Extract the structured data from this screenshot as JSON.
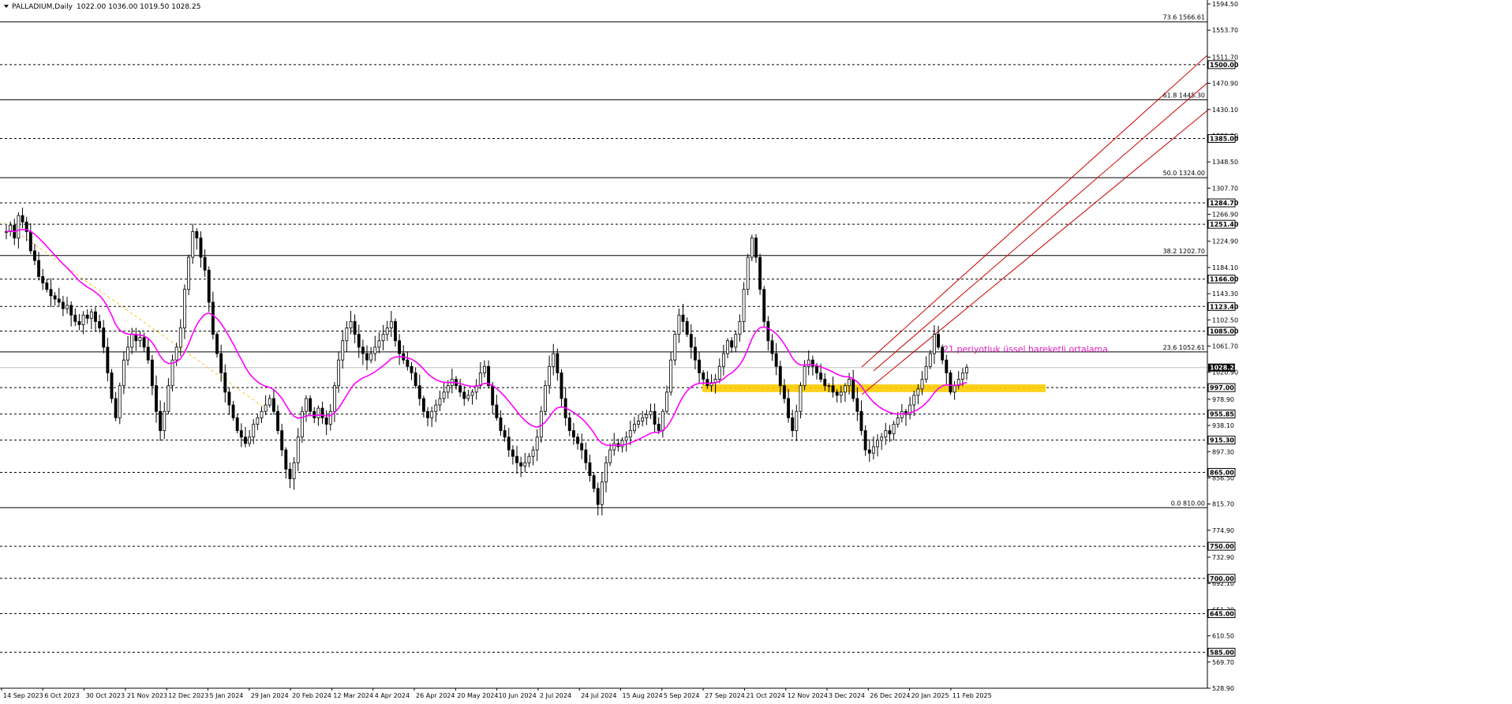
{
  "header": {
    "symbol_label": "PALLADIUM,Daily",
    "ohlc": "1022.00 1036.00 1019.50 1028.25"
  },
  "colors": {
    "background": "#ffffff",
    "candles": "#000000",
    "ema": "#ff00ff",
    "channel": "#cc0000",
    "zone": "#ffcc00",
    "guide": "#f5c842",
    "price_box": "#000000"
  },
  "chart_data": {
    "type": "candlestick",
    "title": "PALLADIUM,Daily",
    "ylim": [
      528.9,
      1594.5
    ],
    "y_ticks": [
      "1594.50",
      "1553.70",
      "1511.70",
      "1470.90",
      "1430.10",
      "1389.30",
      "1348.50",
      "1307.70",
      "1266.90",
      "1224.90",
      "1184.10",
      "1143.30",
      "1102.50",
      "1061.70",
      "1020.90",
      "978.90",
      "938.10",
      "897.30",
      "856.50",
      "815.70",
      "774.90",
      "732.90",
      "692.10",
      "651.30",
      "610.50",
      "569.70",
      "528.90"
    ],
    "x_labels": [
      "14 Sep 2023",
      "6 Oct 2023",
      "30 Oct 2023",
      "21 Nov 2023",
      "12 Dec 2023",
      "5 Jan 2024",
      "29 Jan 2024",
      "20 Feb 2024",
      "12 Mar 2024",
      "4 Apr 2024",
      "26 Apr 2024",
      "20 May 2024",
      "10 Jun 2024",
      "2 Jul 2024",
      "24 Jul 2024",
      "15 Aug 2024",
      "5 Sep 2024",
      "27 Sep 2024",
      "21 Oct 2024",
      "12 Nov 2024",
      "3 Dec 2024",
      "26 Dec 2024",
      "20 Jan 2025",
      "11 Feb 2025"
    ],
    "price_levels": [
      {
        "value": 1500.0,
        "label": "1500.00"
      },
      {
        "value": 1385.0,
        "label": "1385.00"
      },
      {
        "value": 1284.7,
        "label": "1284.70"
      },
      {
        "value": 1251.4,
        "label": "1251.40"
      },
      {
        "value": 1166.0,
        "label": "1166.00"
      },
      {
        "value": 1123.4,
        "label": "1123.40"
      },
      {
        "value": 1085.0,
        "label": "1085.00"
      },
      {
        "value": 997.0,
        "label": "997.00"
      },
      {
        "value": 955.85,
        "label": "955.85"
      },
      {
        "value": 915.3,
        "label": "915.30"
      },
      {
        "value": 865.0,
        "label": "865.00"
      },
      {
        "value": 750.0,
        "label": "750.00"
      },
      {
        "value": 700.0,
        "label": "700.00"
      },
      {
        "value": 645.0,
        "label": "645.00"
      },
      {
        "value": 585.0,
        "label": "585.00"
      }
    ],
    "fib_levels": [
      {
        "value": 1566.61,
        "label": "73.6 1566.61"
      },
      {
        "value": 1445.3,
        "label": "61.8 1445.30"
      },
      {
        "value": 1324.0,
        "label": "50.0 1324.00"
      },
      {
        "value": 1202.7,
        "label": "38.2 1202.70"
      },
      {
        "value": 1052.61,
        "label": "23.6 1052.61"
      },
      {
        "value": 810.0,
        "label": "0.0 810.00"
      }
    ],
    "current_price": {
      "value": 1028.25,
      "label": "1028.25"
    },
    "annotation": "21 periyotluk üssel hareketli ortalama",
    "support_zone": {
      "low": 990,
      "high": 1002
    },
    "closes": [
      1240,
      1250,
      1230,
      1265,
      1255,
      1240,
      1210,
      1195,
      1170,
      1160,
      1150,
      1140,
      1135,
      1130,
      1120,
      1125,
      1110,
      1100,
      1095,
      1110,
      1105,
      1115,
      1100,
      1090,
      1060,
      1020,
      980,
      950,
      1000,
      1040,
      1060,
      1080,
      1070,
      1075,
      1060,
      1040,
      1000,
      960,
      930,
      960,
      1000,
      1040,
      1060,
      1090,
      1150,
      1200,
      1240,
      1230,
      1200,
      1180,
      1130,
      1080,
      1050,
      1020,
      990,
      970,
      950,
      930,
      920,
      910,
      920,
      940,
      950,
      960,
      970,
      980,
      960,
      930,
      900,
      870,
      855,
      880,
      920,
      960,
      980,
      960,
      950,
      965,
      950,
      940,
      960,
      1000,
      1040,
      1070,
      1090,
      1100,
      1080,
      1060,
      1050,
      1040,
      1050,
      1060,
      1070,
      1080,
      1090,
      1100,
      1070,
      1050,
      1040,
      1030,
      1020,
      1000,
      980,
      960,
      950,
      960,
      970,
      980,
      990,
      1000,
      1010,
      1000,
      990,
      980,
      985,
      990,
      1000,
      1020,
      1030,
      1000,
      970,
      950,
      930,
      920,
      900,
      890,
      880,
      875,
      880,
      890,
      900,
      920,
      960,
      1000,
      1030,
      1050,
      1020,
      980,
      950,
      930,
      920,
      910,
      900,
      880,
      860,
      840,
      815,
      850,
      880,
      900,
      910,
      905,
      915,
      920,
      930,
      940,
      945,
      950,
      955,
      960,
      940,
      930,
      960,
      990,
      1040,
      1080,
      1110,
      1100,
      1080,
      1060,
      1040,
      1020,
      1010,
      1000,
      1005,
      1010,
      1030,
      1050,
      1070,
      1060,
      1080,
      1100,
      1150,
      1200,
      1230,
      1200,
      1150,
      1100,
      1070,
      1050,
      1030,
      1000,
      980,
      950,
      930,
      960,
      1000,
      1030,
      1040,
      1030,
      1020,
      1010,
      1000,
      1000,
      990,
      985,
      990,
      1000,
      1010,
      980,
      960,
      930,
      900,
      895,
      905,
      915,
      920,
      930,
      925,
      940,
      950,
      960,
      955,
      970,
      985,
      995,
      1010,
      1030,
      1050,
      1080,
      1060,
      1040,
      1020,
      990,
      1000,
      1010,
      1020,
      1028.25
    ]
  }
}
